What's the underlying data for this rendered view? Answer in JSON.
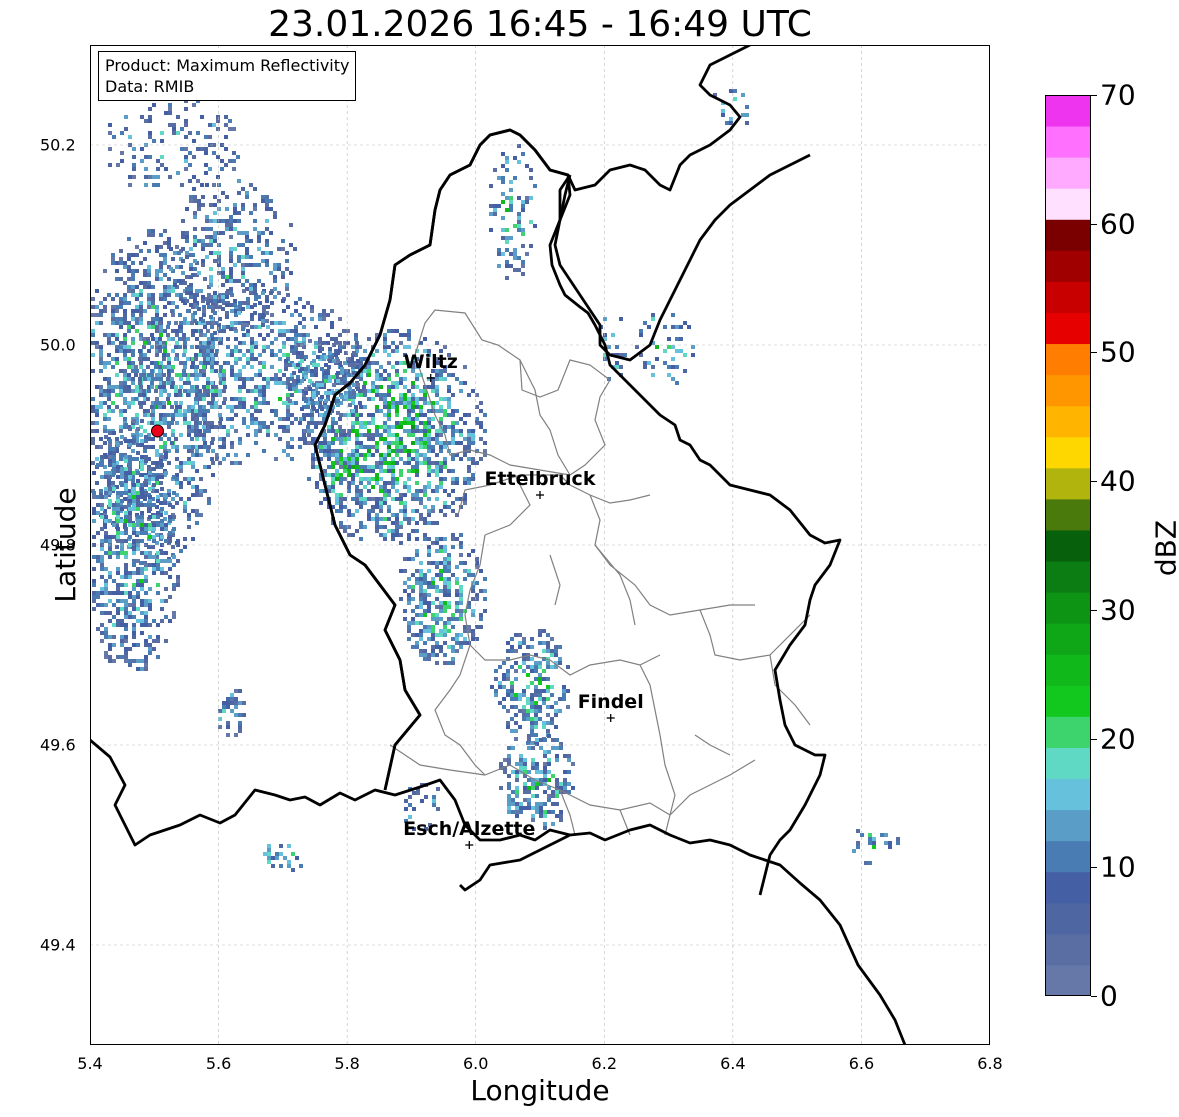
{
  "title": "23.01.2026 16:45 - 16:49 UTC",
  "info": {
    "product": "Product: Maximum Reflectivity",
    "data_source": "Data: RMIB"
  },
  "axes": {
    "xlabel": "Longitude",
    "ylabel": "Latitude",
    "xlim": [
      5.4,
      6.8
    ],
    "ylim": [
      49.3,
      50.3
    ],
    "xticks": [
      "5.4",
      "5.6",
      "5.8",
      "6.0",
      "6.2",
      "6.4",
      "6.6",
      "6.8"
    ],
    "yticks": [
      "49.4",
      "49.6",
      "49.8",
      "50.0",
      "50.2"
    ],
    "grid": true
  },
  "cities": [
    {
      "name": "Wiltz",
      "lon": 5.93,
      "lat": 49.967
    },
    {
      "name": "Ettelbruck",
      "lon": 6.1,
      "lat": 49.85
    },
    {
      "name": "Findel",
      "lon": 6.21,
      "lat": 49.627
    },
    {
      "name": "Esch/Alzette",
      "lon": 5.99,
      "lat": 49.5
    }
  ],
  "radar_site": {
    "lon": 5.505,
    "lat": 49.914,
    "color": "#e8001a"
  },
  "colorbar": {
    "label": "dBZ",
    "ticks": [
      "0",
      "10",
      "20",
      "30",
      "40",
      "50",
      "60",
      "70"
    ],
    "range": [
      0,
      70
    ],
    "colors": [
      "#6578a8",
      "#5a6ea4",
      "#4e66a2",
      "#445fa3",
      "#4a7cb4",
      "#5a9ec8",
      "#66c2dc",
      "#5fd8c4",
      "#3dd46d",
      "#12c81f",
      "#10b81a",
      "#0fa618",
      "#0d9415",
      "#0b7d12",
      "#07600c",
      "#4a7a0c",
      "#b0b40c",
      "#ffd700",
      "#ffb400",
      "#ff9600",
      "#ff7d00",
      "#e60000",
      "#c80000",
      "#a00000",
      "#7a0000",
      "#ffe0ff",
      "#ffaaff",
      "#ff70ff",
      "#ee34ee"
    ]
  }
}
